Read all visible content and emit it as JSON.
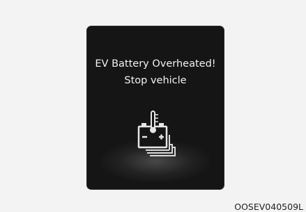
{
  "warning": {
    "line1": "EV Battery Overheated!",
    "line2": "Stop vehicle"
  },
  "icon": "battery-overheat-icon",
  "image_code": "OOSEV040509L"
}
